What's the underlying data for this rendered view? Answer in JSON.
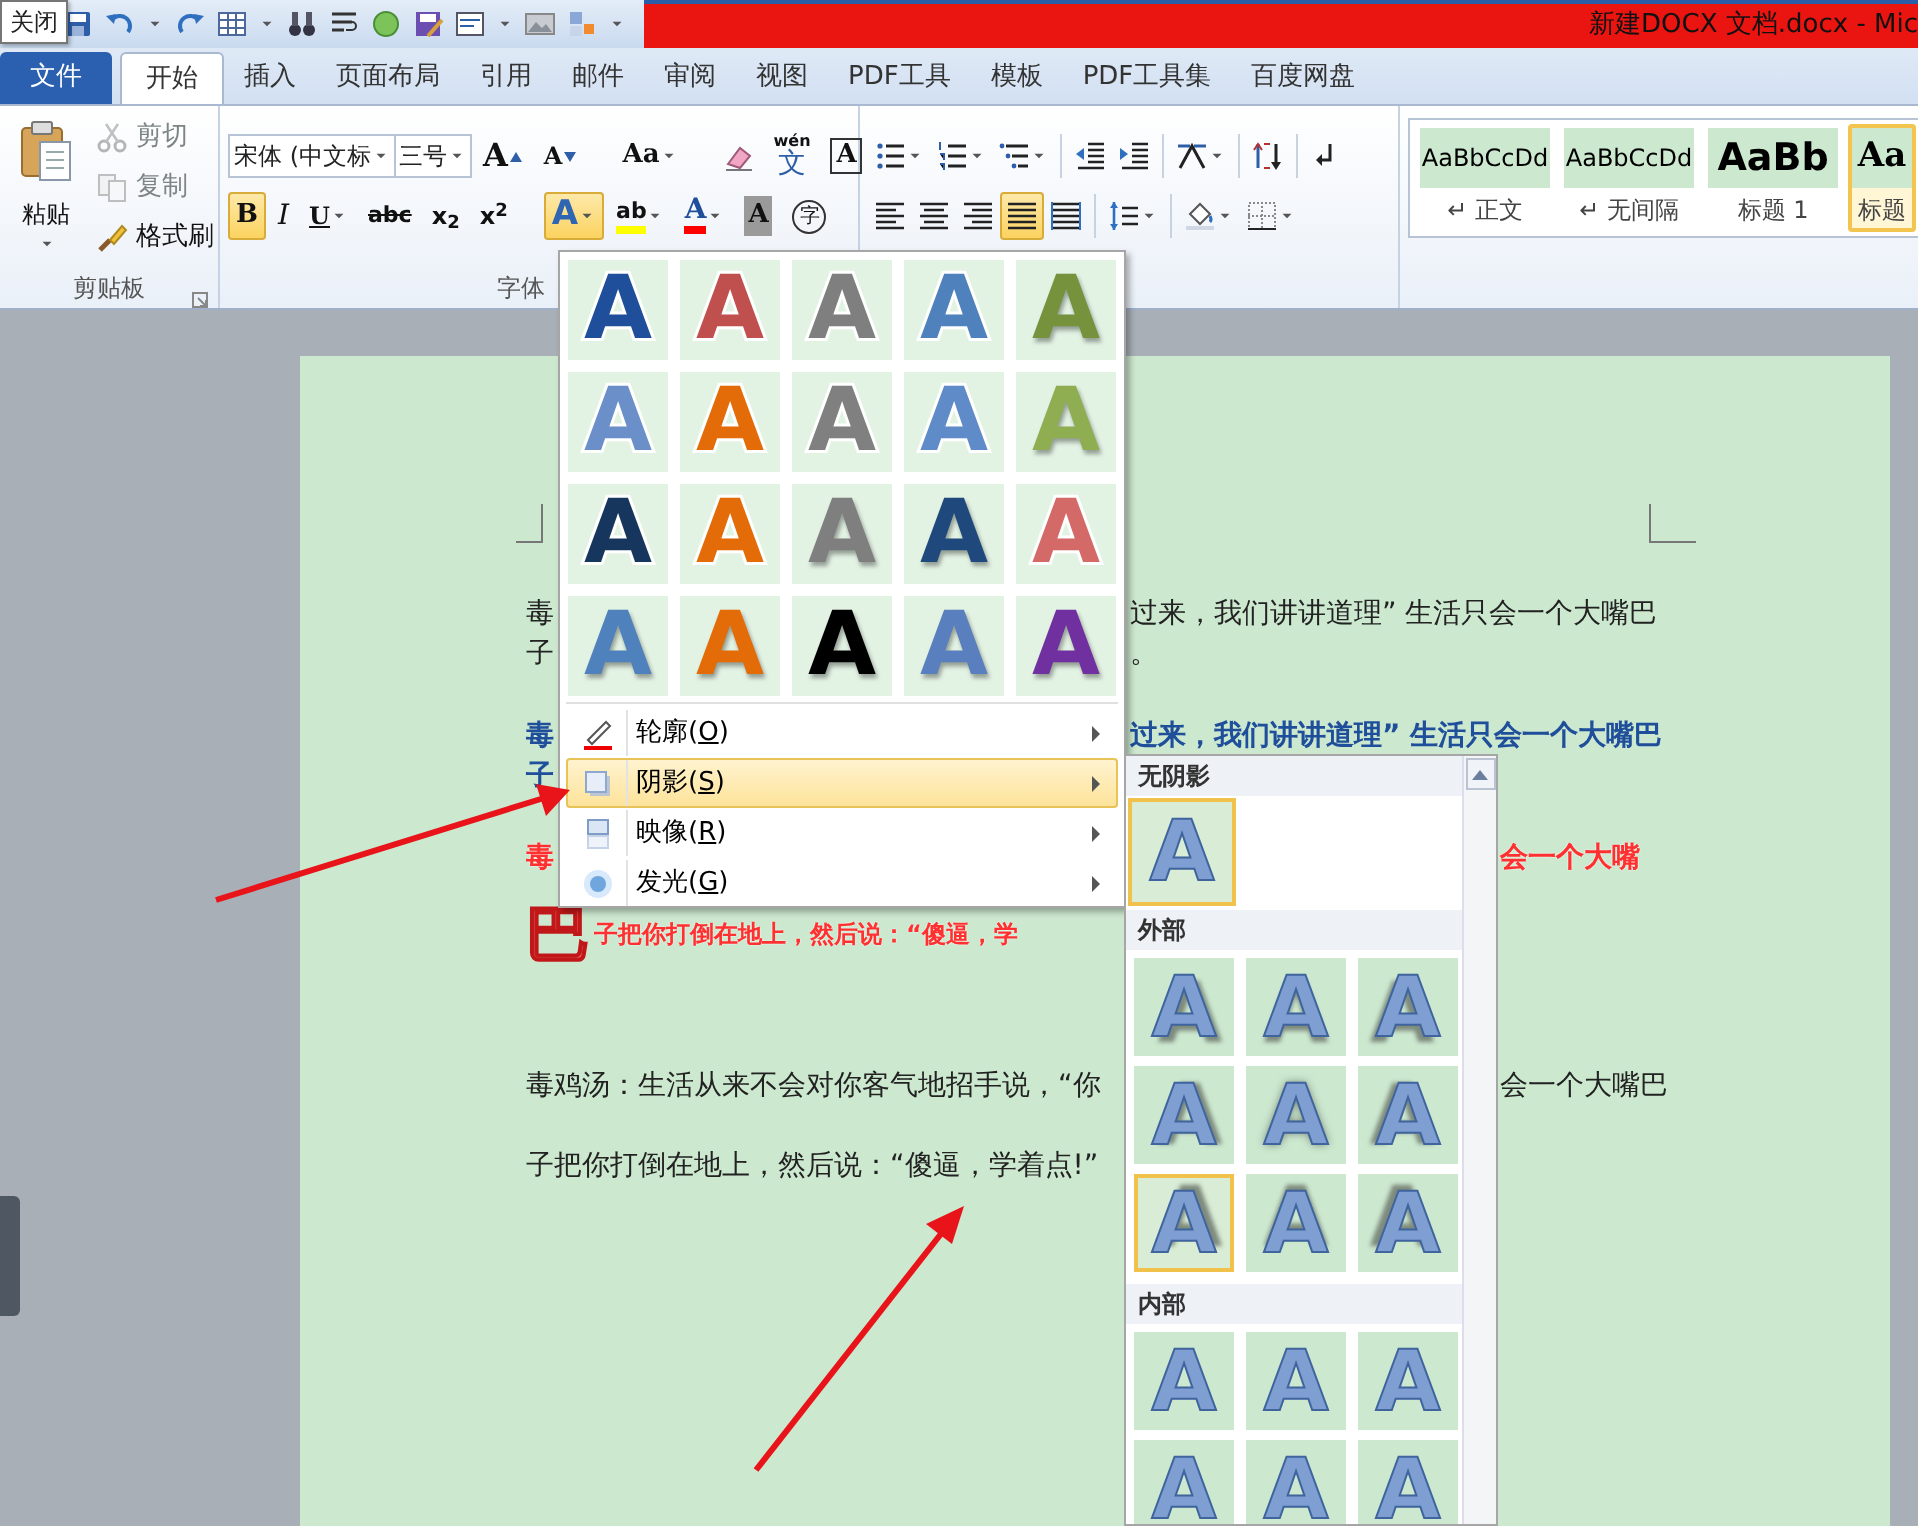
{
  "tooltip": {
    "text": "关闭"
  },
  "window": {
    "title": "新建DOCX 文档.docx  -  Mic"
  },
  "ribbon_tabs": [
    {
      "label": "文件",
      "kind": "file",
      "selected": false
    },
    {
      "label": "开始",
      "kind": "tab",
      "selected": true
    },
    {
      "label": "插入",
      "kind": "tab",
      "selected": false
    },
    {
      "label": "页面布局",
      "kind": "tab",
      "selected": false
    },
    {
      "label": "引用",
      "kind": "tab",
      "selected": false
    },
    {
      "label": "邮件",
      "kind": "tab",
      "selected": false
    },
    {
      "label": "审阅",
      "kind": "tab",
      "selected": false
    },
    {
      "label": "视图",
      "kind": "tab",
      "selected": false
    },
    {
      "label": "PDF工具",
      "kind": "tab",
      "selected": false
    },
    {
      "label": "模板",
      "kind": "tab",
      "selected": false
    },
    {
      "label": "PDF工具集",
      "kind": "tab",
      "selected": false
    },
    {
      "label": "百度网盘",
      "kind": "tab",
      "selected": false
    }
  ],
  "clipboard": {
    "label": "剪贴板",
    "paste": "粘贴",
    "items": [
      {
        "label": "剪切",
        "kind": "cut",
        "disabled": true
      },
      {
        "label": "复制",
        "kind": "copy",
        "disabled": true
      },
      {
        "label": "格式刷",
        "kind": "brush",
        "disabled": false
      }
    ]
  },
  "font": {
    "label": "字体",
    "font_name": "宋体 (中文标",
    "font_size": "三号",
    "row1": [
      {
        "kind": "grow",
        "label": "A"
      },
      {
        "kind": "shrink",
        "label": "A"
      },
      {
        "kind": "case",
        "label": "Aa"
      },
      {
        "kind": "clear"
      },
      {
        "kind": "pinyin",
        "label": "文",
        "ruby": "wén"
      },
      {
        "kind": "border",
        "label": "A"
      }
    ],
    "row2": [
      {
        "kind": "bold",
        "label": "B",
        "selected": true
      },
      {
        "kind": "italic",
        "label": "I",
        "selected": false
      },
      {
        "kind": "underline",
        "label": "U",
        "selected": false
      },
      {
        "kind": "strike",
        "label": "abc",
        "selected": false
      },
      {
        "kind": "sub",
        "label": "x$_{2}$",
        "selected": false
      },
      {
        "kind": "sup",
        "label": "x$^{2}$",
        "selected": false
      },
      {
        "kind": "effect",
        "label": "A",
        "selected": true
      },
      {
        "kind": "highlight",
        "label": "ab",
        "color": "#ffff00",
        "selected": false
      },
      {
        "kind": "fontcolor",
        "label": "A",
        "color": "#ff0000",
        "selected": false
      },
      {
        "kind": "shading",
        "label": "A",
        "selected": false
      },
      {
        "kind": "enclose",
        "label": "字",
        "selected": false
      }
    ]
  },
  "alignment": [
    {
      "kind": "left",
      "selected": false
    },
    {
      "kind": "center",
      "selected": false
    },
    {
      "kind": "right",
      "selected": false
    },
    {
      "kind": "justify",
      "selected": true
    },
    {
      "kind": "distribute",
      "selected": false
    }
  ],
  "styles": [
    {
      "sample": "AaBbCcDd",
      "label": "↵ 正文",
      "kind": "normal",
      "selected": false
    },
    {
      "sample": "AaBbCcDd",
      "label": "↵ 无间隔",
      "kind": "normal",
      "selected": false
    },
    {
      "sample": "AaBb",
      "label": "标题 1",
      "kind": "heading1",
      "selected": false
    },
    {
      "sample": "Aa",
      "label": "标题",
      "kind": "heading2",
      "selected": true
    }
  ],
  "document": {
    "paragraphs": [
      {
        "kind": "plain",
        "lines": [
          {
            "left": "毒",
            "right": "过来，我们讲讲道理” 生活只会一个大嘴巴"
          },
          {
            "left": "子",
            "right": "。"
          }
        ]
      },
      {
        "kind": "blue-bold",
        "lines": [
          {
            "left": "毒",
            "right": "过来，我们讲讲道理” 生活只会一个大嘴巴"
          },
          {
            "left": "子"
          }
        ]
      },
      {
        "kind": "red-outline",
        "lines": [
          {
            "left": "毒",
            "right": "会一个大嘴"
          },
          {
            "dropcap": "巴",
            "left": "子把你打倒在地上，然后说：“傻逼，学"
          }
        ]
      },
      {
        "kind": "plain",
        "lines": [
          {
            "left": "毒鸡汤：生活从来不会对你客气地招手说，“你",
            "right": "会一个大嘴巴"
          },
          {
            "left": "子把你打倒在地上，然后说：“傻逼，学着点!”"
          }
        ]
      }
    ]
  },
  "text_effects_menu": {
    "gallery": [
      {
        "label": "A",
        "color": "#1f4e9a",
        "kind": "outline"
      },
      {
        "label": "A",
        "color": "#c0504d",
        "kind": "outline"
      },
      {
        "label": "A",
        "color": "#7f7f7f",
        "kind": "outline"
      },
      {
        "label": "A",
        "color": "#4f81bd",
        "kind": "outline"
      },
      {
        "label": "A",
        "color": "#76923c",
        "kind": "fill"
      },
      {
        "label": "A",
        "color": "#6b8fc9",
        "kind": "outline"
      },
      {
        "label": "A",
        "color": "#e36c09",
        "kind": "outline"
      },
      {
        "label": "A",
        "color": "#808080",
        "kind": "outline"
      },
      {
        "label": "A",
        "color": "#5f8cc8",
        "kind": "outline"
      },
      {
        "label": "A",
        "color": "#8fae52",
        "kind": "fill"
      },
      {
        "label": "A",
        "color": "#17365d",
        "kind": "outline"
      },
      {
        "label": "A",
        "color": "#e36c09",
        "kind": "outline"
      },
      {
        "label": "A",
        "color": "#7f7f7f",
        "kind": "fill"
      },
      {
        "label": "A",
        "color": "#1f497d",
        "kind": "fill"
      },
      {
        "label": "A",
        "color": "#d46a68",
        "kind": "outline"
      },
      {
        "label": "A",
        "color": "#4f81bd",
        "kind": "fill"
      },
      {
        "label": "A",
        "color": "#e36c09",
        "kind": "fill"
      },
      {
        "label": "A",
        "color": "#000000",
        "kind": "fill"
      },
      {
        "label": "A",
        "color": "#5a7fbf",
        "kind": "fill"
      },
      {
        "label": "A",
        "color": "#7030a0",
        "kind": "fill"
      }
    ],
    "items": [
      {
        "label": "轮廓(O)",
        "kind": "outline",
        "selected": false
      },
      {
        "label": "阴影(S)",
        "kind": "shadow",
        "selected": true
      },
      {
        "label": "映像(R)",
        "kind": "reflection",
        "selected": false
      },
      {
        "label": "发光(G)",
        "kind": "glow",
        "selected": false
      }
    ]
  },
  "shadow_submenu": {
    "sections": [
      {
        "title": "无阴影",
        "tiles": [
          {
            "label": "A",
            "selected": true
          }
        ]
      },
      {
        "title": "外部",
        "tiles": [
          {
            "label": "A",
            "selected": false
          },
          {
            "label": "A",
            "selected": false
          },
          {
            "label": "A",
            "selected": false
          },
          {
            "label": "A",
            "selected": false
          },
          {
            "label": "A",
            "selected": false
          },
          {
            "label": "A",
            "selected": false
          },
          {
            "label": "A",
            "selected": true
          },
          {
            "label": "A",
            "selected": false
          },
          {
            "label": "A",
            "selected": false
          }
        ]
      },
      {
        "title": "内部",
        "tiles": [
          {
            "label": "A",
            "selected": false
          },
          {
            "label": "A",
            "selected": false
          },
          {
            "label": "A",
            "selected": false
          },
          {
            "label": "A",
            "selected": false
          },
          {
            "label": "A",
            "selected": false
          },
          {
            "label": "A",
            "selected": false
          }
        ]
      }
    ]
  }
}
